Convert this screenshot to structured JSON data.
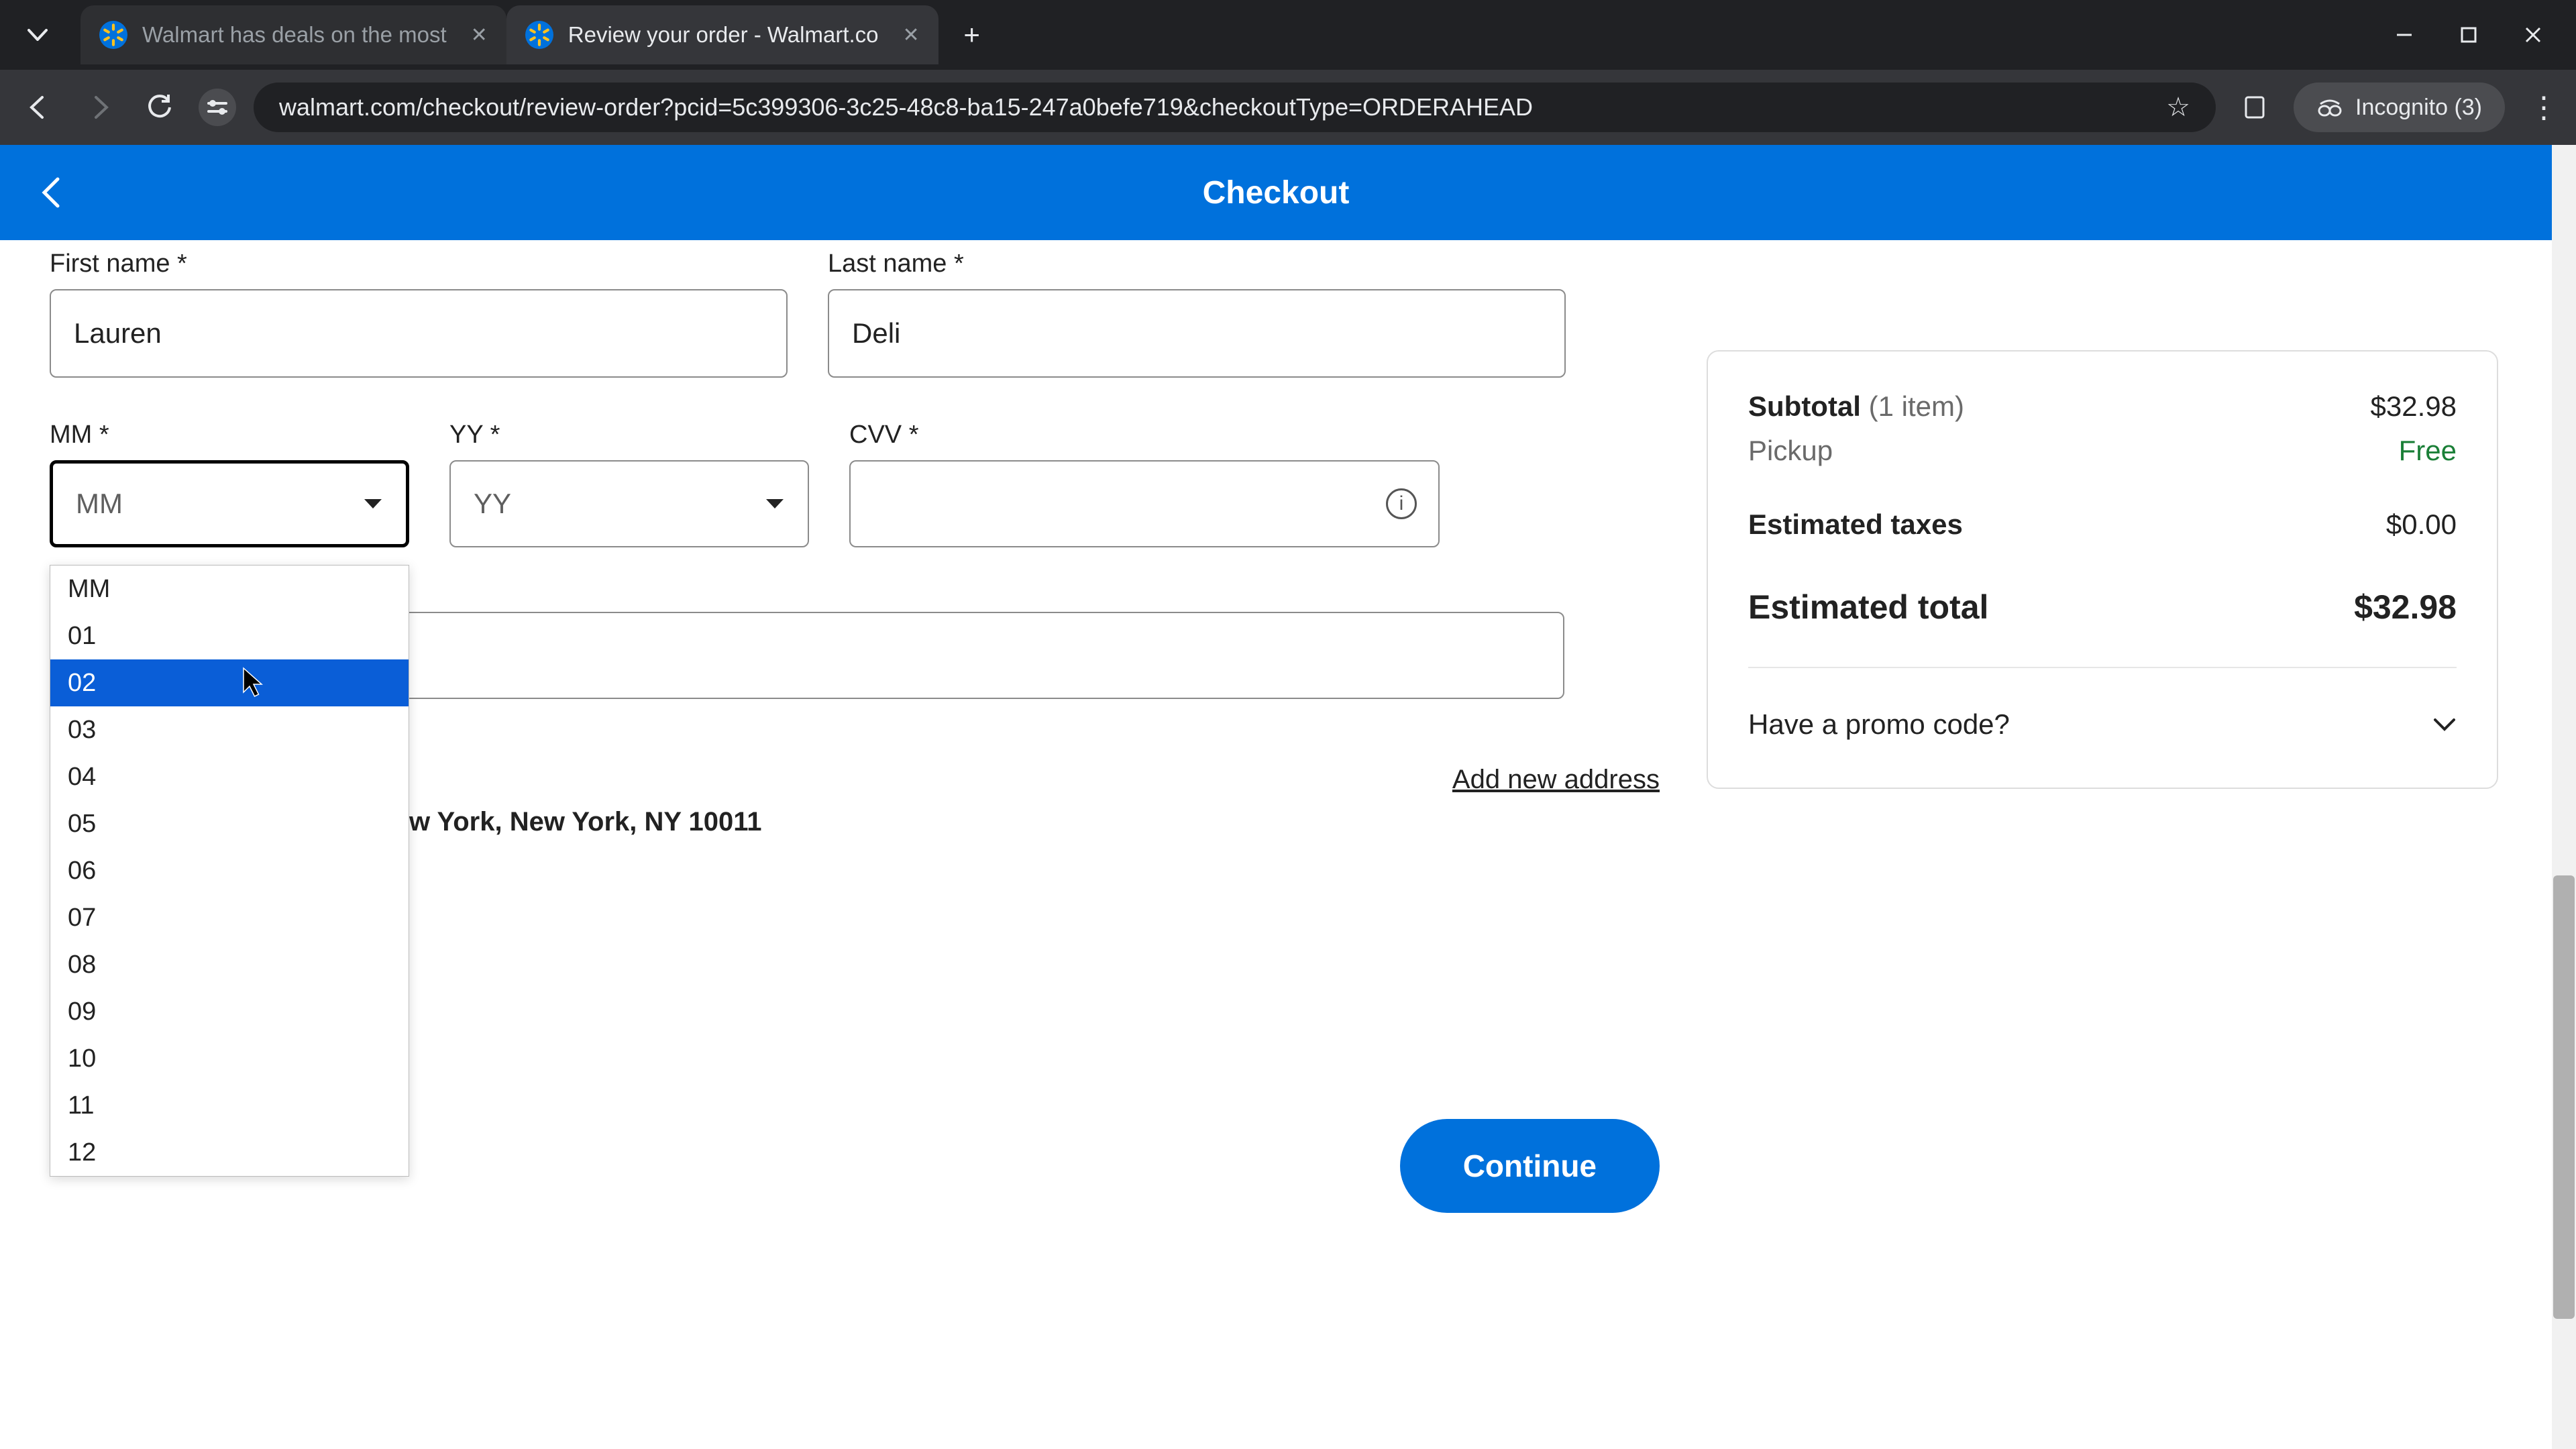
{
  "browser": {
    "tabs": [
      {
        "title": "Walmart has deals on the most",
        "active": false
      },
      {
        "title": "Review your order - Walmart.co",
        "active": true
      }
    ],
    "url_display": "walmart.com/checkout/review-order?pcid=5c399306-3c25-48c8-ba15-247a0befe719&checkoutType=ORDERAHEAD",
    "incognito_label": "Incognito (3)"
  },
  "header": {
    "title": "Checkout"
  },
  "form": {
    "first_name_label": "First name *",
    "first_name_value": "Lauren",
    "last_name_label": "Last name *",
    "last_name_value": "Deli",
    "mm_label": "MM *",
    "mm_selected": "MM",
    "mm_options": [
      "MM",
      "01",
      "02",
      "03",
      "04",
      "05",
      "06",
      "07",
      "08",
      "09",
      "10",
      "11",
      "12"
    ],
    "mm_highlighted": "02",
    "yy_label": "YY *",
    "yy_selected": "YY",
    "cvv_label": "CVV *",
    "add_address": "Add new address",
    "address_fragment": "w York, New York, NY 10011",
    "continue": "Continue"
  },
  "summary": {
    "subtotal_label": "Subtotal",
    "subtotal_count": "(1 item)",
    "subtotal_value": "$32.98",
    "pickup_label": "Pickup",
    "pickup_value": "Free",
    "taxes_label": "Estimated taxes",
    "taxes_value": "$0.00",
    "total_label": "Estimated total",
    "total_value": "$32.98",
    "promo_label": "Have a promo code?"
  }
}
